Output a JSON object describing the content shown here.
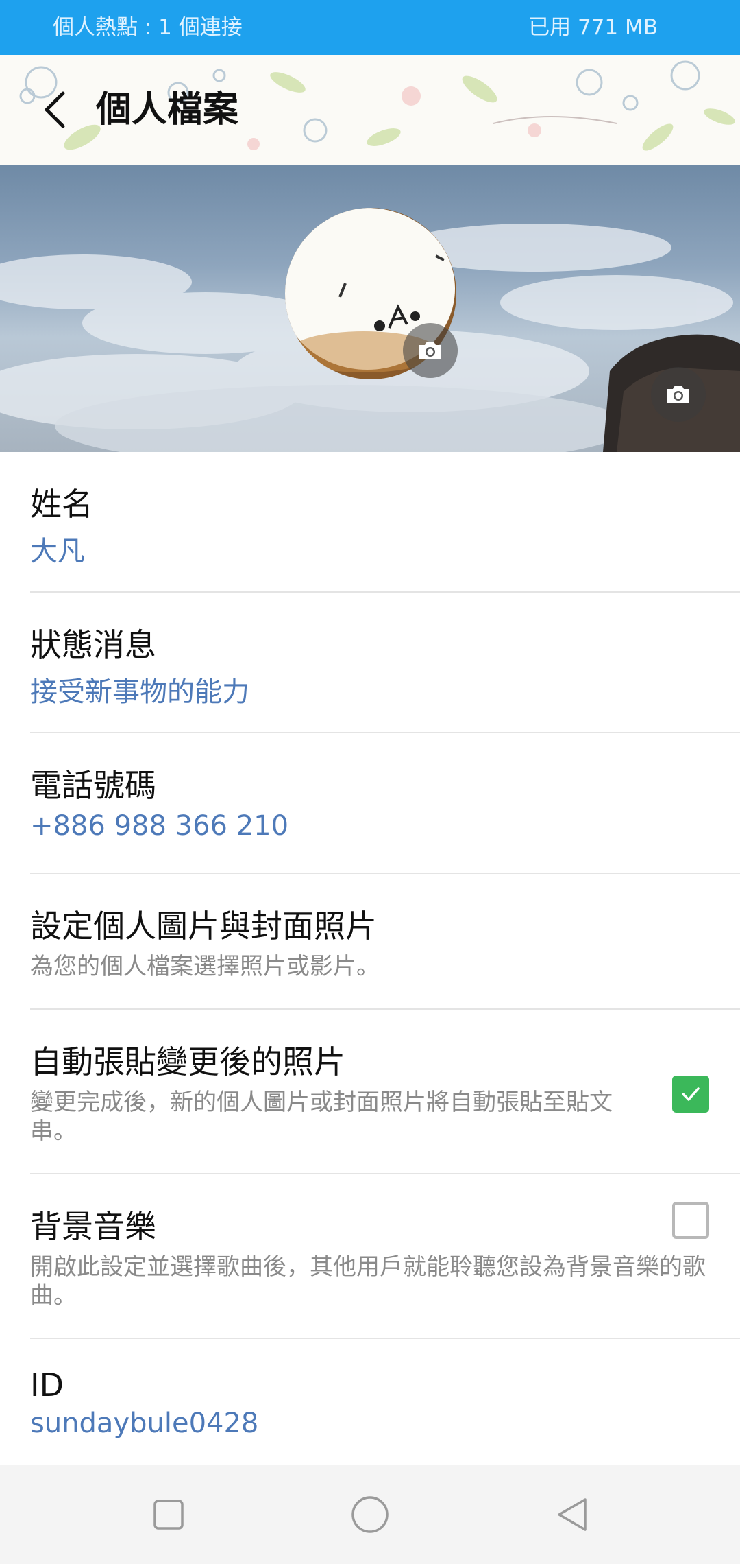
{
  "status_bar": {
    "hotspot_text": "個人熱點 : 1 個連接",
    "data_used_text": "已用 771 MB"
  },
  "header": {
    "title": "個人檔案",
    "back_icon": "chevron-left-icon"
  },
  "cover": {
    "avatar_camera_icon": "camera-icon",
    "cover_camera_icon": "camera-icon"
  },
  "profile": {
    "name_label": "姓名",
    "name_value": "大凡",
    "status_label": "狀態消息",
    "status_value": "接受新事物的能力",
    "phone_label": "電話號碼",
    "phone_value": "+886 988 366 210",
    "photo_setting_label": "設定個人圖片與封面照片",
    "photo_setting_desc": "為您的個人檔案選擇照片或影片。",
    "auto_post_label": "自動張貼變更後的照片",
    "auto_post_desc": "變更完成後，新的個人圖片或封面照片將自動張貼至貼文串。",
    "auto_post_checked": true,
    "bgm_label": "背景音樂",
    "bgm_desc": "開啟此設定並選擇歌曲後，其他用戶就能聆聽您設為背景音樂的歌曲。",
    "bgm_checked": false,
    "id_label": "ID",
    "id_value": "sundaybule0428"
  },
  "colors": {
    "status_bar": "#1ea1ee",
    "value_text": "#4d79b8",
    "checkbox_on": "#3bb85a"
  },
  "nav_bar": {
    "recent_icon": "square-icon",
    "home_icon": "circle-icon",
    "back_icon": "triangle-back-icon"
  }
}
